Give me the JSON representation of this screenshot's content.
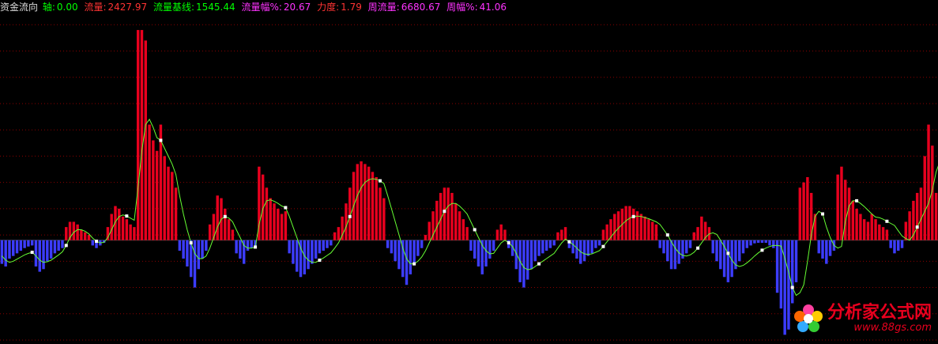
{
  "header": {
    "title": "资金流向",
    "items": [
      {
        "label": "轴:",
        "value": "0.00",
        "color": "#00ff00"
      },
      {
        "label": "流量:",
        "value": "2427.97",
        "color": "#ff3333"
      },
      {
        "label": "流量基线:",
        "value": "1545.44",
        "color": "#00ff00"
      },
      {
        "label": "流量幅%:",
        "value": "20.67",
        "color": "#ff33ff"
      },
      {
        "label": "力度:",
        "value": "1.79",
        "color": "#ff3333"
      },
      {
        "label": "周流量:",
        "value": "6680.67",
        "color": "#ff33ff"
      },
      {
        "label": "周幅%:",
        "value": "41.06",
        "color": "#ff33ff"
      }
    ]
  },
  "logo": {
    "name": "分析家公式网",
    "url_text": "www.88gs.com"
  },
  "chart_data": {
    "type": "bar",
    "axis_value": 0,
    "ylim": [
      -1900,
      4300
    ],
    "grid": true,
    "colors": {
      "positive": "#e8001e",
      "negative": "#3c3cff",
      "line": "#66ff33",
      "marker": "#ffffff",
      "grid": "#8b0000"
    },
    "values": [
      -450,
      -500,
      -350,
      -300,
      -250,
      -200,
      -150,
      -120,
      -100,
      -500,
      -600,
      -550,
      -400,
      -350,
      -250,
      -200,
      -150,
      250,
      350,
      350,
      300,
      200,
      150,
      100,
      -100,
      -150,
      -100,
      -50,
      250,
      500,
      650,
      600,
      450,
      400,
      300,
      250,
      4000,
      4000,
      3800,
      2200,
      1900,
      1700,
      2200,
      1600,
      1400,
      1300,
      1000,
      -200,
      -350,
      -500,
      -700,
      -900,
      -550,
      -350,
      -200,
      300,
      500,
      850,
      800,
      600,
      400,
      200,
      -250,
      -350,
      -450,
      -200,
      -150,
      -100,
      1400,
      1250,
      1000,
      800,
      700,
      600,
      500,
      550,
      -250,
      -450,
      -600,
      -700,
      -650,
      -550,
      -450,
      -350,
      -250,
      -200,
      -150,
      -100,
      150,
      250,
      450,
      700,
      1000,
      1300,
      1450,
      1500,
      1450,
      1400,
      1300,
      1200,
      1000,
      800,
      -150,
      -250,
      -400,
      -550,
      -700,
      -850,
      -650,
      -450,
      -300,
      -150,
      100,
      350,
      550,
      750,
      900,
      1000,
      1000,
      900,
      700,
      550,
      400,
      250,
      -200,
      -350,
      -500,
      -650,
      -500,
      -350,
      -200,
      200,
      300,
      200,
      -150,
      -300,
      -550,
      -800,
      -900,
      -750,
      -550,
      -400,
      -300,
      -250,
      -200,
      -150,
      -100,
      150,
      200,
      250,
      -150,
      -250,
      -350,
      -450,
      -400,
      -300,
      -250,
      -150,
      -100,
      200,
      300,
      400,
      500,
      550,
      600,
      650,
      650,
      600,
      550,
      500,
      450,
      400,
      350,
      300,
      -150,
      -250,
      -400,
      -550,
      -550,
      -450,
      -350,
      -250,
      -150,
      150,
      250,
      450,
      350,
      250,
      -250,
      -400,
      -550,
      -700,
      -800,
      -700,
      -550,
      -400,
      -250,
      -150,
      -100,
      -60,
      -50,
      -50,
      -50,
      -100,
      -150,
      -1000,
      -1300,
      -1800,
      -1700,
      -1200,
      -800,
      1000,
      1100,
      1200,
      900,
      500,
      -250,
      -350,
      -450,
      -300,
      -200,
      1250,
      1400,
      1150,
      1000,
      750,
      600,
      500,
      400,
      350,
      500,
      400,
      300,
      250,
      200,
      -150,
      -250,
      -200,
      -150,
      350,
      550,
      750,
      900,
      1000,
      1600,
      2200,
      1800,
      900
    ],
    "line": [
      -300,
      -380,
      -420,
      -400,
      -360,
      -320,
      -280,
      -250,
      -230,
      -300,
      -380,
      -420,
      -410,
      -380,
      -330,
      -280,
      -220,
      -100,
      50,
      150,
      200,
      200,
      170,
      120,
      40,
      -20,
      -50,
      -40,
      50,
      200,
      350,
      450,
      480,
      460,
      420,
      380,
      1000,
      1700,
      2200,
      2300,
      2150,
      1950,
      1900,
      1750,
      1600,
      1450,
      1250,
      850,
      500,
      200,
      -50,
      -250,
      -350,
      -350,
      -300,
      -150,
      50,
      250,
      400,
      450,
      420,
      350,
      200,
      50,
      -100,
      -150,
      -150,
      -130,
      300,
      600,
      750,
      770,
      740,
      700,
      650,
      620,
      450,
      250,
      50,
      -150,
      -300,
      -380,
      -420,
      -420,
      -380,
      -340,
      -290,
      -240,
      -150,
      -50,
      100,
      250,
      450,
      650,
      850,
      1000,
      1100,
      1150,
      1170,
      1160,
      1130,
      1080,
      850,
      600,
      350,
      100,
      -150,
      -350,
      -450,
      -450,
      -400,
      -320,
      -200,
      -50,
      100,
      250,
      400,
      550,
      650,
      700,
      700,
      650,
      580,
      500,
      350,
      200,
      50,
      -100,
      -200,
      -260,
      -250,
      -150,
      -50,
      0,
      -50,
      -120,
      -250,
      -400,
      -520,
      -560,
      -550,
      -500,
      -450,
      -400,
      -350,
      -300,
      -250,
      -150,
      -50,
      20,
      -30,
      -80,
      -150,
      -220,
      -260,
      -270,
      -260,
      -230,
      -200,
      -120,
      -30,
      60,
      150,
      230,
      300,
      370,
      420,
      450,
      460,
      450,
      430,
      410,
      380,
      350,
      300,
      200,
      100,
      -30,
      -150,
      -240,
      -290,
      -300,
      -280,
      -230,
      -150,
      -50,
      50,
      120,
      140,
      110,
      0,
      -120,
      -250,
      -380,
      -470,
      -500,
      -480,
      -430,
      -370,
      -300,
      -240,
      -190,
      -150,
      -120,
      -100,
      -100,
      -110,
      -350,
      -600,
      -900,
      -1050,
      -1000,
      -850,
      -400,
      100,
      450,
      550,
      500,
      250,
      50,
      -100,
      -150,
      -120,
      350,
      650,
      750,
      750,
      700,
      640,
      570,
      500,
      440,
      430,
      400,
      360,
      320,
      280,
      180,
      80,
      30,
      0,
      100,
      250,
      400,
      550,
      700,
      950,
      1300,
      1500,
      1400
    ],
    "markers": [
      40,
      80,
      120,
      160,
      200,
      240,
      280,
      320,
      360,
      400,
      440,
      480,
      520,
      560,
      600,
      640,
      680,
      720,
      760,
      800,
      840,
      880,
      920,
      960,
      1000,
      1040,
      1080,
      1120,
      1160
    ]
  }
}
